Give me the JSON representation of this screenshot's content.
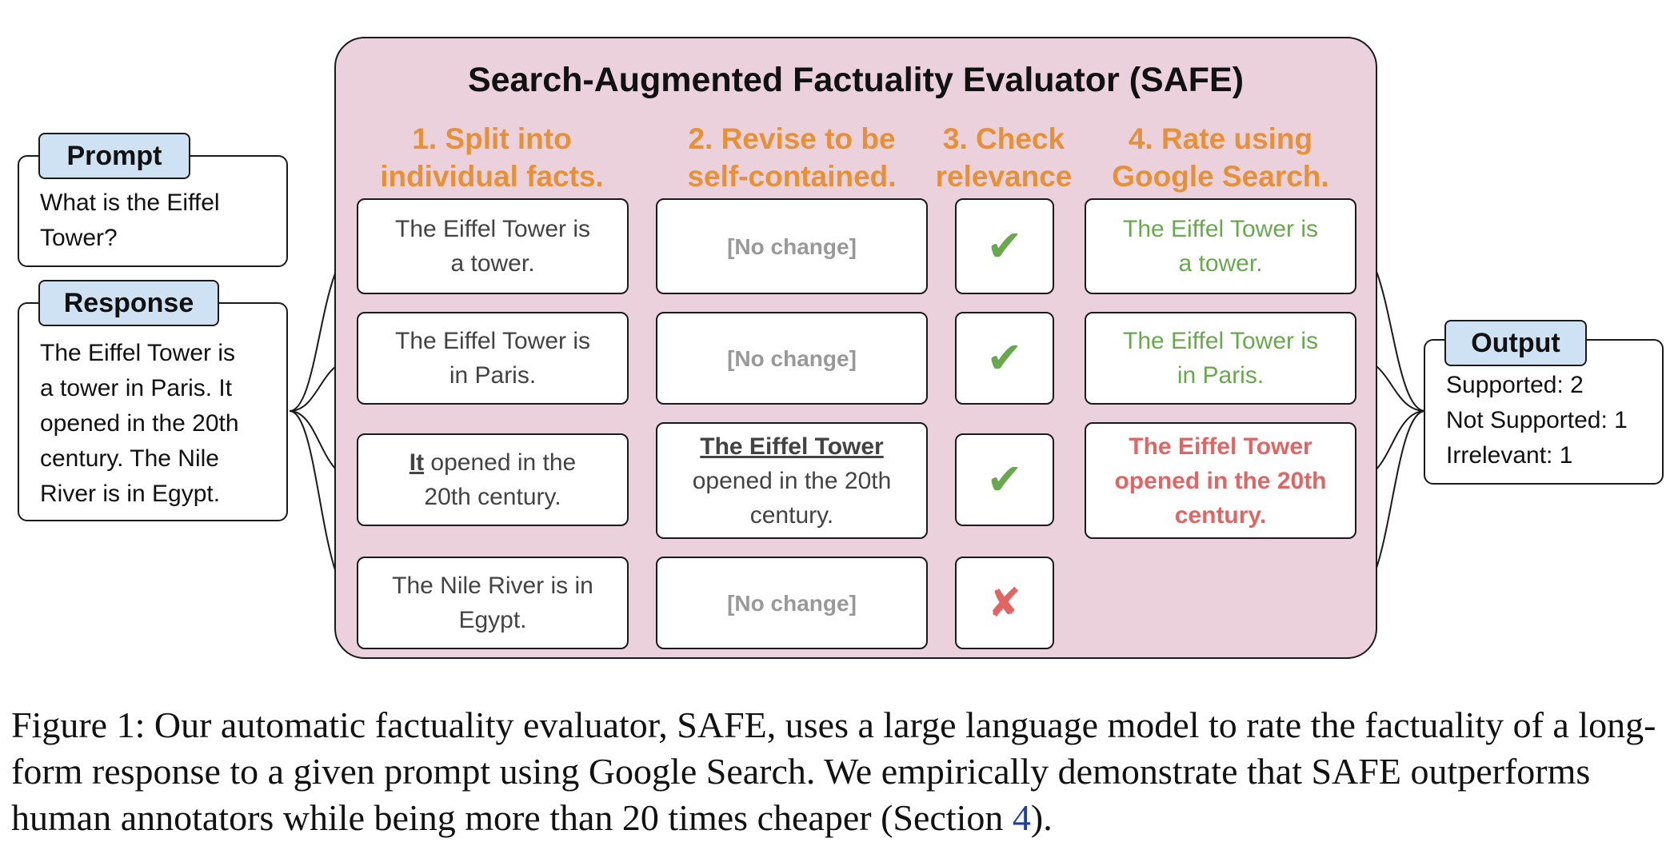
{
  "title": "Search-Augmented Factuality Evaluator (SAFE)",
  "steps": [
    {
      "line1": "1. Split into",
      "line2": "individual facts."
    },
    {
      "line1": "2. Revise to be",
      "line2": "self-contained."
    },
    {
      "line1": "3. Check",
      "line2": "relevance"
    },
    {
      "line1": "4. Rate using",
      "line2": "Google Search."
    }
  ],
  "prompt": {
    "label": "Prompt",
    "line1": "What is the Eiffel",
    "line2": "Tower?"
  },
  "response": {
    "label": "Response",
    "lines": [
      "The Eiffel Tower is",
      "a tower in Paris. It",
      "opened in the 20th",
      "century. The Nile",
      "River is in Egypt."
    ]
  },
  "facts": [
    {
      "line1": "The Eiffel Tower is",
      "line2": "a tower."
    },
    {
      "line1": "The Eiffel Tower is",
      "line2": "in Paris."
    },
    {
      "pronoun": "It",
      "line1_rest": " opened in the",
      "line2": "20th century."
    },
    {
      "line1": "The Nile River is in",
      "line2": "Egypt."
    }
  ],
  "revisions": {
    "no_change": "[No change]",
    "revised_subject": "The Eiffel Tower",
    "revised_line2": "opened in the 20th",
    "revised_line3": "century."
  },
  "relevance": {
    "relevant_glyph": "✔",
    "irrelevant_glyph": "✘",
    "values": [
      true,
      true,
      true,
      false
    ]
  },
  "ratings": [
    {
      "line1": "The Eiffel Tower is",
      "line2": "a tower.",
      "supported": true
    },
    {
      "line1": "The Eiffel Tower is",
      "line2": "in Paris.",
      "supported": true
    },
    {
      "line1": "The Eiffel Tower",
      "line2": "opened in the 20th",
      "line3": "century.",
      "supported": false
    }
  ],
  "output": {
    "label": "Output",
    "supported": "Supported: 2",
    "not_supported": "Not Supported: 1",
    "irrelevant": "Irrelevant: 1"
  },
  "caption": {
    "text": "Figure 1: Our automatic factuality evaluator, SAFE, uses a large language model to rate the factuality of a long-form response to a given prompt using Google Search. We empirically demonstrate that SAFE outperforms human annotators while being more than 20 times cheaper (Section ",
    "ref": "4",
    "tail": ")."
  },
  "colors": {
    "panel": "#ead1dc",
    "step_header": "#e69138",
    "supported": "#6aa84f",
    "not_supported": "#e06666",
    "tag": "#cfe2f3",
    "no_change": "#999999",
    "ref_link": "#1f3f9e"
  }
}
